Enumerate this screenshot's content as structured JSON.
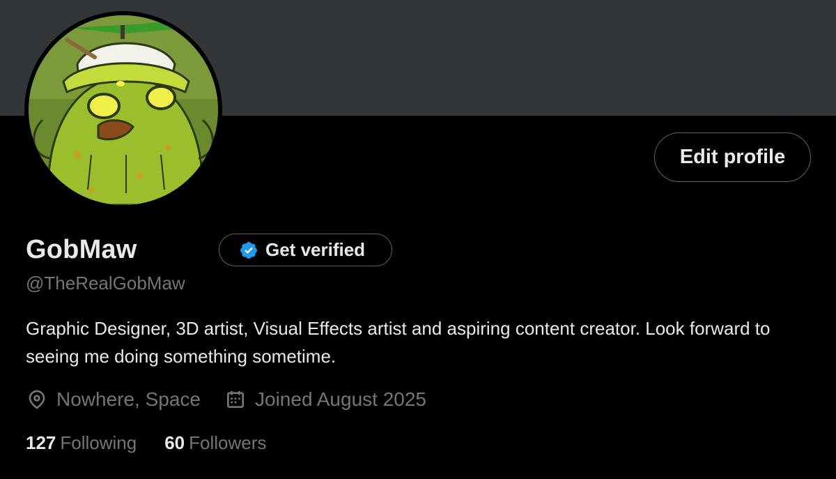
{
  "profile": {
    "display_name": "GobMaw",
    "handle": "@TheRealGobMaw",
    "bio": "Graphic Designer, 3D artist, Visual Effects artist and aspiring content creator. Look forward to seeing me doing something sometime.",
    "location": "Nowhere, Space",
    "joined": "Joined August 2025",
    "avatar_description": "green-creature-propeller-hat-avatar"
  },
  "actions": {
    "edit_profile_label": "Edit profile",
    "get_verified_label": "Get verified"
  },
  "stats": {
    "following_count": "127",
    "following_label": "Following",
    "followers_count": "60",
    "followers_label": "Followers"
  },
  "icons": {
    "verified": "verified-badge-icon",
    "location": "location-pin-icon",
    "calendar": "calendar-icon"
  },
  "colors": {
    "banner": "#333639",
    "background": "#000000",
    "primary_text": "#e7e9ea",
    "secondary_text": "#71767b",
    "button_border": "#536471",
    "verified_blue": "#1d9bf0"
  }
}
